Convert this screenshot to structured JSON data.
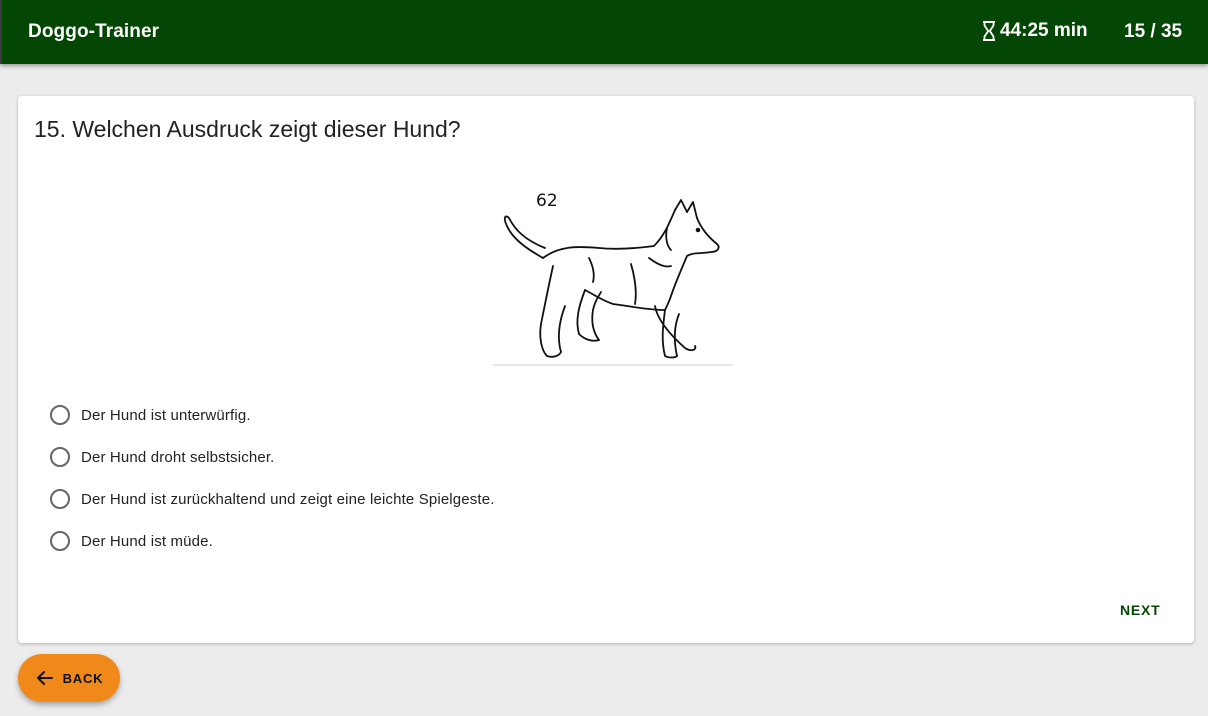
{
  "header": {
    "title": "Doggo-Trainer",
    "timer_icon": "hourglass-icon",
    "timer": "44:25 min",
    "progress": "15 / 35",
    "background_color": "#044704"
  },
  "question": {
    "text": "15. Welchen Ausdruck zeigt dieser Hund?",
    "image": {
      "icon": "dog-illustration",
      "figure_number": "62"
    },
    "options": [
      {
        "label": "Der Hund ist unterwürfig.",
        "selected": false
      },
      {
        "label": "Der Hund droht selbstsicher.",
        "selected": false
      },
      {
        "label": "Der Hund ist zurückhaltend und zeigt eine leichte Spielgeste.",
        "selected": false
      },
      {
        "label": "Der Hund ist müde.",
        "selected": false
      }
    ]
  },
  "actions": {
    "next_label": "NEXT",
    "back_label": "BACK",
    "back_icon": "arrow-left-icon",
    "back_color": "#f0891a"
  }
}
